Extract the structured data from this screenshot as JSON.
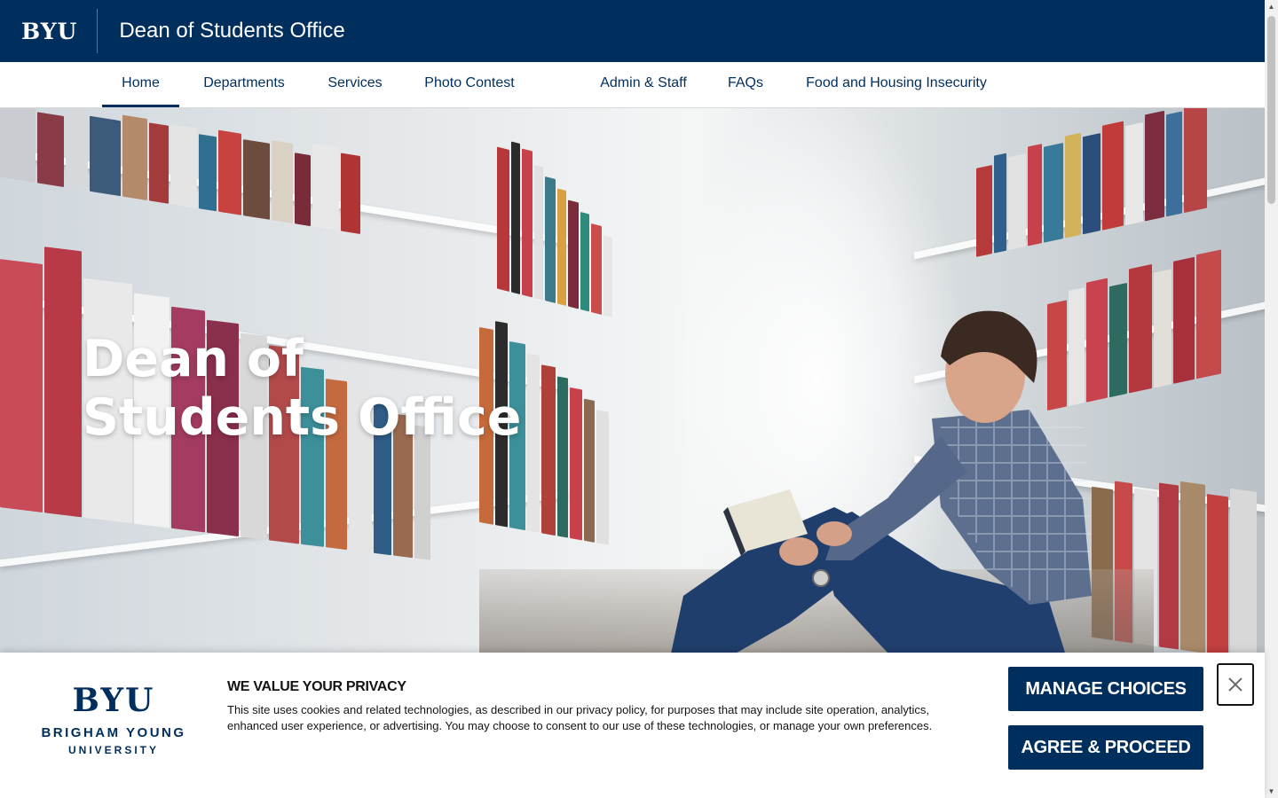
{
  "header": {
    "logo": "BYU",
    "site_title": "Dean of Students Office"
  },
  "nav": {
    "items": [
      {
        "label": "Home",
        "active": true
      },
      {
        "label": "Departments"
      },
      {
        "label": "Services"
      },
      {
        "label": "Photo Contest"
      },
      {
        "label": "Admin & Staff"
      },
      {
        "label": "FAQs"
      },
      {
        "label": "Food and Housing Insecurity"
      }
    ]
  },
  "hero": {
    "heading": "Dean of\nStudents Office"
  },
  "cookie_banner": {
    "logo_mark": "BYU",
    "logo_line1": "BRIGHAM YOUNG",
    "logo_line2": "UNIVERSITY",
    "title": "WE VALUE YOUR PRIVACY",
    "text": "This site uses cookies and related technologies, as described in our privacy policy, for purposes that may include site operation, analytics, enhanced user experience, or advertising. You may choose to consent to our use of these technologies, or manage your own preferences.",
    "manage_label": "MANAGE CHOICES",
    "agree_label": "AGREE & PROCEED",
    "close_icon": "close-icon"
  },
  "colors": {
    "brand_navy": "#002E5D",
    "white": "#FFFFFF",
    "text_dark": "#141414"
  }
}
